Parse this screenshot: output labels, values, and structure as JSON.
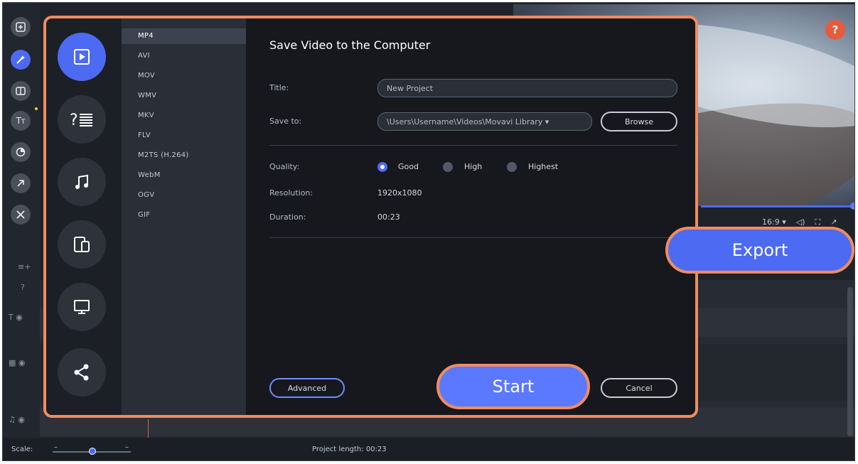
{
  "preview": {
    "aspect": "16:9 ▾",
    "help": "?"
  },
  "sidebar_tools": [
    "import-icon",
    "magic-wand-icon",
    "transitions-icon",
    "titles-icon",
    "filters-icon",
    "callouts-icon",
    "more-tools-icon"
  ],
  "bottom": {
    "scale_label": "Scale:",
    "project_length": "Project length: 00:23"
  },
  "export_button": "Export",
  "dialog": {
    "title": "Save Video to the Computer",
    "categories": [
      "video-file",
      "hdr-formats",
      "audio",
      "devices",
      "tv",
      "share"
    ],
    "formats": [
      "MP4",
      "AVI",
      "MOV",
      "WMV",
      "MKV",
      "FLV",
      "M2TS (H.264)",
      "WebM",
      "OGV",
      "GIF"
    ],
    "selected_format": "MP4",
    "title_label": "Title:",
    "title_value": "New Project",
    "save_to_label": "Save to:",
    "save_to_value": "\\Users\\Username\\Videos\\Movavi Library ▾",
    "browse": "Browse",
    "quality_label": "Quality:",
    "quality_options": [
      "Good",
      "High",
      "Highest"
    ],
    "quality_selected": "Good",
    "resolution_label": "Resolution:",
    "resolution_value": "1920x1080",
    "duration_label": "Duration:",
    "duration_value": "00:23",
    "advanced": "Advanced",
    "start": "Start",
    "cancel": "Cancel"
  },
  "colors": {
    "accent": "#4d6af2",
    "highlight_outline": "#f08c60",
    "help": "#e85a3c"
  }
}
